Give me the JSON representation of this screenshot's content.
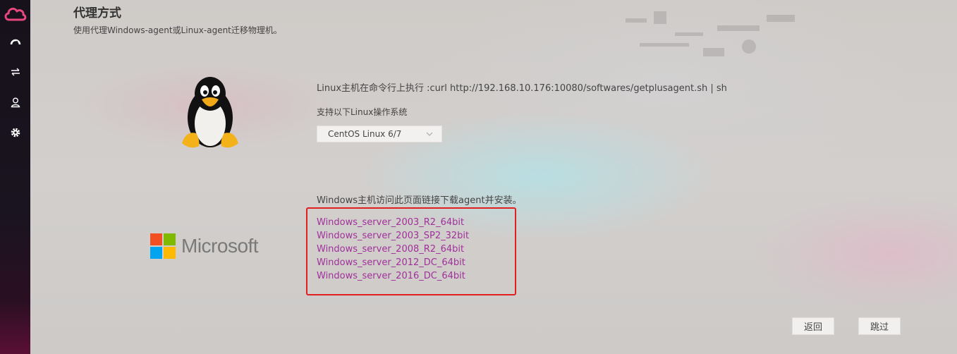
{
  "sidebar": {
    "icons": [
      "cloud-logo-icon",
      "dashboard-icon",
      "transfer-icon",
      "user-icon",
      "gear-icon"
    ]
  },
  "page": {
    "title": "代理方式",
    "subtitle": "使用代理Windows-agent或Linux-agent迁移物理机。"
  },
  "linux": {
    "command_text": "Linux主机在命令行上执行 :curl http://192.168.10.176:10080/softwares/getplusagent.sh | sh",
    "support_label": "支持以下Linux操作系统",
    "selected_os": "CentOS Linux 6/7"
  },
  "windows": {
    "logo_text": "Microsoft",
    "instruction": "Windows主机访问此页面链接下载agent并安装。",
    "downloads": [
      "Windows_server_2003_R2_64bit",
      "Windows_server_2003_SP2_32bit",
      "Windows_server_2008_R2_64bit",
      "Windows_server_2012_DC_64bit",
      "Windows_server_2016_DC_64bit"
    ]
  },
  "buttons": {
    "back": "返回",
    "skip": "跳过"
  },
  "colors": {
    "link": "#a0309a",
    "highlight_border": "#e02020",
    "ms_red": "#f25022",
    "ms_green": "#7fba00",
    "ms_blue": "#00a4ef",
    "ms_yellow": "#ffb900"
  }
}
